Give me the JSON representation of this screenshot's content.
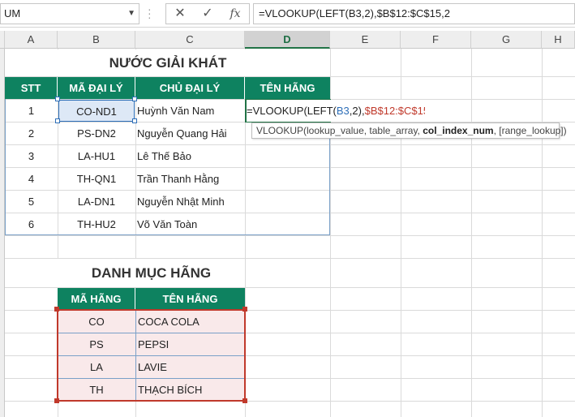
{
  "formula_bar": {
    "name_box": "UM",
    "cancel_icon": "✕",
    "enter_icon": "✓",
    "fx_label": "fx",
    "formula": "=VLOOKUP(LEFT(B3,2),$B$12:$C$15,2"
  },
  "columns": [
    "A",
    "B",
    "C",
    "D",
    "E",
    "F",
    "G",
    "H"
  ],
  "title1": "NƯỚC GIẢI KHÁT",
  "table1": {
    "headers": [
      "STT",
      "MÃ ĐẠI LÝ",
      "CHỦ ĐẠI LÝ",
      "TÊN HÃNG"
    ],
    "rows": [
      {
        "stt": "1",
        "ma": "CO-ND1",
        "chu": "Huỳnh Văn Nam"
      },
      {
        "stt": "2",
        "ma": "PS-DN2",
        "chu": "Nguyễn Quang Hải"
      },
      {
        "stt": "3",
        "ma": "LA-HU1",
        "chu": "Lê Thế Bảo"
      },
      {
        "stt": "4",
        "ma": "TH-QN1",
        "chu": "Trần Thanh Hằng"
      },
      {
        "stt": "5",
        "ma": "LA-DN1",
        "chu": "Nguyễn Nhật Minh"
      },
      {
        "stt": "6",
        "ma": "TH-HU2",
        "chu": "Võ Văn Toàn"
      }
    ]
  },
  "edit_cell": {
    "p1": "=VLOOKUP(LEFT(",
    "p2": "B3",
    "p3": ",2),",
    "p4": "$B$12:$C$15",
    "p5": ",2"
  },
  "tooltip": {
    "fn": "VLOOKUP(",
    "a1": "lookup_value, table_array, ",
    "a2": "col_index_num",
    "a3": ", [range_lookup])"
  },
  "title2": "DANH MỤC HÃNG",
  "table2": {
    "headers": [
      "MÃ HÃNG",
      "TÊN HÃNG"
    ],
    "rows": [
      {
        "ma": "CO",
        "ten": "COCA COLA"
      },
      {
        "ma": "PS",
        "ten": "PEPSI"
      },
      {
        "ma": "LA",
        "ten": "LAVIE"
      },
      {
        "ma": "TH",
        "ten": "THẠCH BÍCH"
      }
    ]
  },
  "colors": {
    "header_green": "#0e8260",
    "ref_blue": "#2e6fb8",
    "ref_red": "#c0392b",
    "pink_fill": "#f9e9ea"
  }
}
